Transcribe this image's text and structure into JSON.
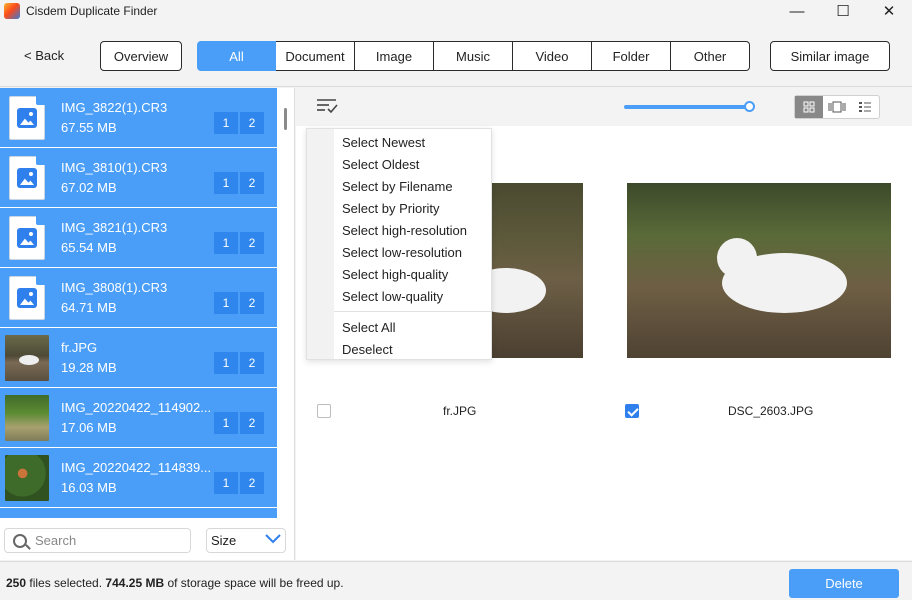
{
  "window": {
    "title": "Cisdem Duplicate Finder",
    "minimize": "—",
    "maximize": "☐",
    "close": "✕"
  },
  "nav": {
    "back": "< Back",
    "overview": "Overview",
    "tabs": [
      "All",
      "Document",
      "Image",
      "Music",
      "Video",
      "Folder",
      "Other"
    ],
    "active_tab": "All",
    "similar": "Similar image"
  },
  "files": [
    {
      "name": "IMG_3822(1).CR3",
      "size": "67.55 MB",
      "badges": [
        "1",
        "2"
      ],
      "thumb": "image-file-icon"
    },
    {
      "name": "IMG_3810(1).CR3",
      "size": "67.02 MB",
      "badges": [
        "1",
        "2"
      ],
      "thumb": "image-file-icon"
    },
    {
      "name": "IMG_3821(1).CR3",
      "size": "65.54 MB",
      "badges": [
        "1",
        "2"
      ],
      "thumb": "image-file-icon"
    },
    {
      "name": "IMG_3808(1).CR3",
      "size": "64.71 MB",
      "badges": [
        "1",
        "2"
      ],
      "thumb": "image-file-icon"
    },
    {
      "name": "fr.JPG",
      "size": "19.28 MB",
      "badges": [
        "1",
        "2"
      ],
      "thumb": "dog-photo"
    },
    {
      "name": "IMG_20220422_114902...",
      "size": "17.06 MB",
      "badges": [
        "1",
        "2"
      ],
      "thumb": "garden-photo"
    },
    {
      "name": "IMG_20220422_114839...",
      "size": "16.03 MB",
      "badges": [
        "1",
        "2"
      ],
      "thumb": "flower-photo"
    }
  ],
  "search": {
    "placeholder": "Search",
    "value": ""
  },
  "sort": {
    "value": "Size"
  },
  "menu": {
    "items": [
      "Select Newest",
      "Select Oldest",
      "Select by Filename",
      "Select by Priority",
      "Select high-resolution",
      "Select low-resolution",
      "Select high-quality",
      "Select low-quality"
    ],
    "items2": [
      "Select All",
      "Deselect"
    ]
  },
  "preview": {
    "left": {
      "caption": "fr.JPG",
      "checked": false
    },
    "right": {
      "caption": "DSC_2603.JPG",
      "checked": true
    }
  },
  "footer": {
    "count": "250",
    "count_suffix": " files selected.",
    "size": "744.25 MB",
    "size_suffix": " of storage space will be freed up.",
    "delete": "Delete"
  },
  "colors": {
    "accent": "#4a9ef7",
    "badge": "#2f86ec"
  }
}
